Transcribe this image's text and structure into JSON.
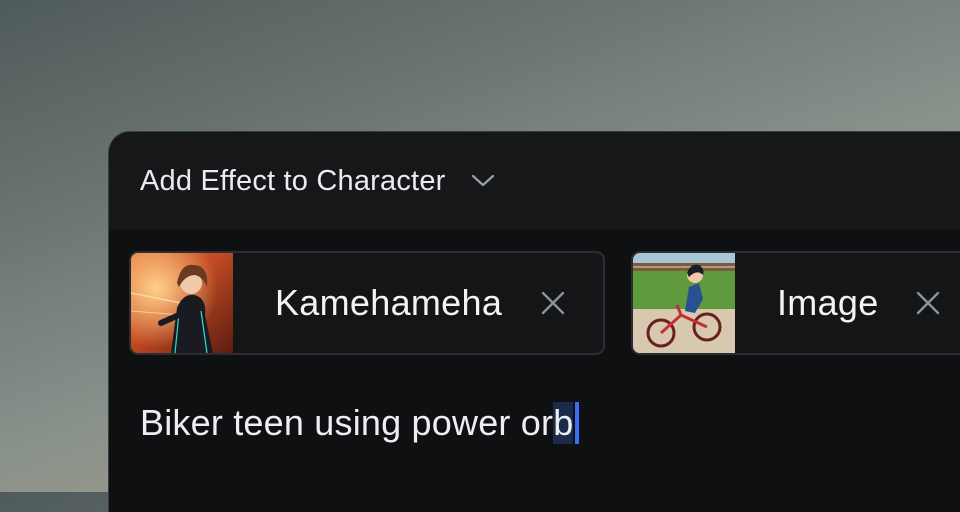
{
  "header": {
    "title": "Add Effect to Character"
  },
  "chips": [
    {
      "label": "Kamehameha",
      "thumbnail": "anime-girl-energy-thumbnail",
      "remove_icon": "close-icon"
    },
    {
      "label": "Image",
      "thumbnail": "biker-teen-thumbnail",
      "remove_icon": "close-icon"
    }
  ],
  "prompt": {
    "text_before": "Biker teen using power or",
    "text_selected": "b"
  },
  "colors": {
    "panel_bg": "#0f1012",
    "header_bg": "#161719",
    "caret": "#3d6df2",
    "text": "#eceef1"
  }
}
